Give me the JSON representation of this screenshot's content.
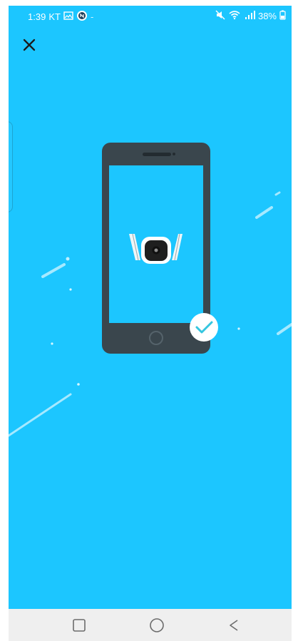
{
  "status_bar": {
    "time": "1:39",
    "carrier": "KT",
    "battery": "38%"
  },
  "icons": {
    "close": "close-icon",
    "success": "checkmark-icon",
    "camera": "camera-icon",
    "nav_recent": "square-icon",
    "nav_home": "circle-icon",
    "nav_back": "back-triangle-icon"
  },
  "colors": {
    "background": "#1cc6ff",
    "phone_body": "#3a464d",
    "phone_screen": "#1cc6ff",
    "check": "#35c6df"
  }
}
